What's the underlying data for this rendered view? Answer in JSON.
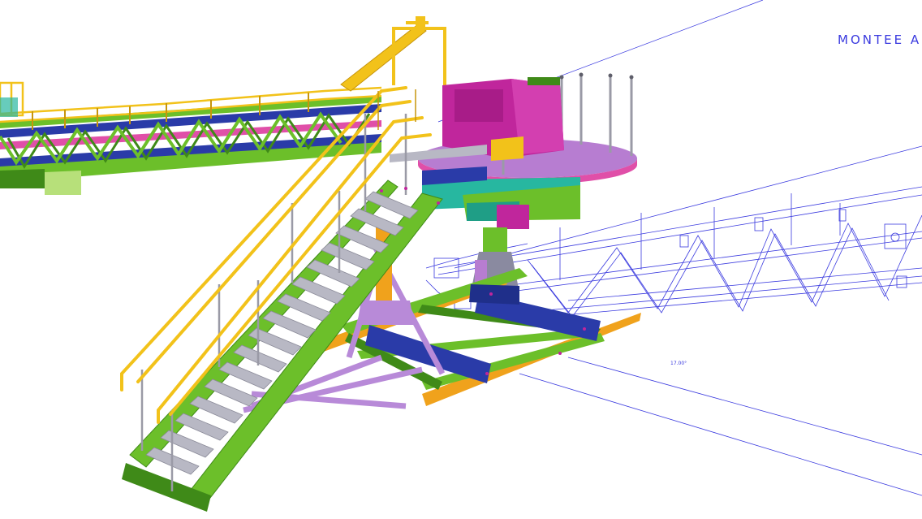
{
  "view": {
    "annotation_title": "MONTEE A",
    "dimension_label": "17.00°"
  },
  "colors": {
    "frame_green": "#6cbf2a",
    "frame_green_dark": "#3f8a18",
    "handrail_yellow": "#f2c21a",
    "handrail_yellow_dark": "#c7950c",
    "beam_blue": "#2a3ba8",
    "drive_magenta": "#c0269c",
    "platform_violet": "#b77dd1",
    "brace_violet": "#b88ad8",
    "base_orange": "#f0a21c",
    "tread_grey": "#b8b8c4",
    "teal_plate": "#27b7a0",
    "wire_blue": "#3a3adf"
  }
}
